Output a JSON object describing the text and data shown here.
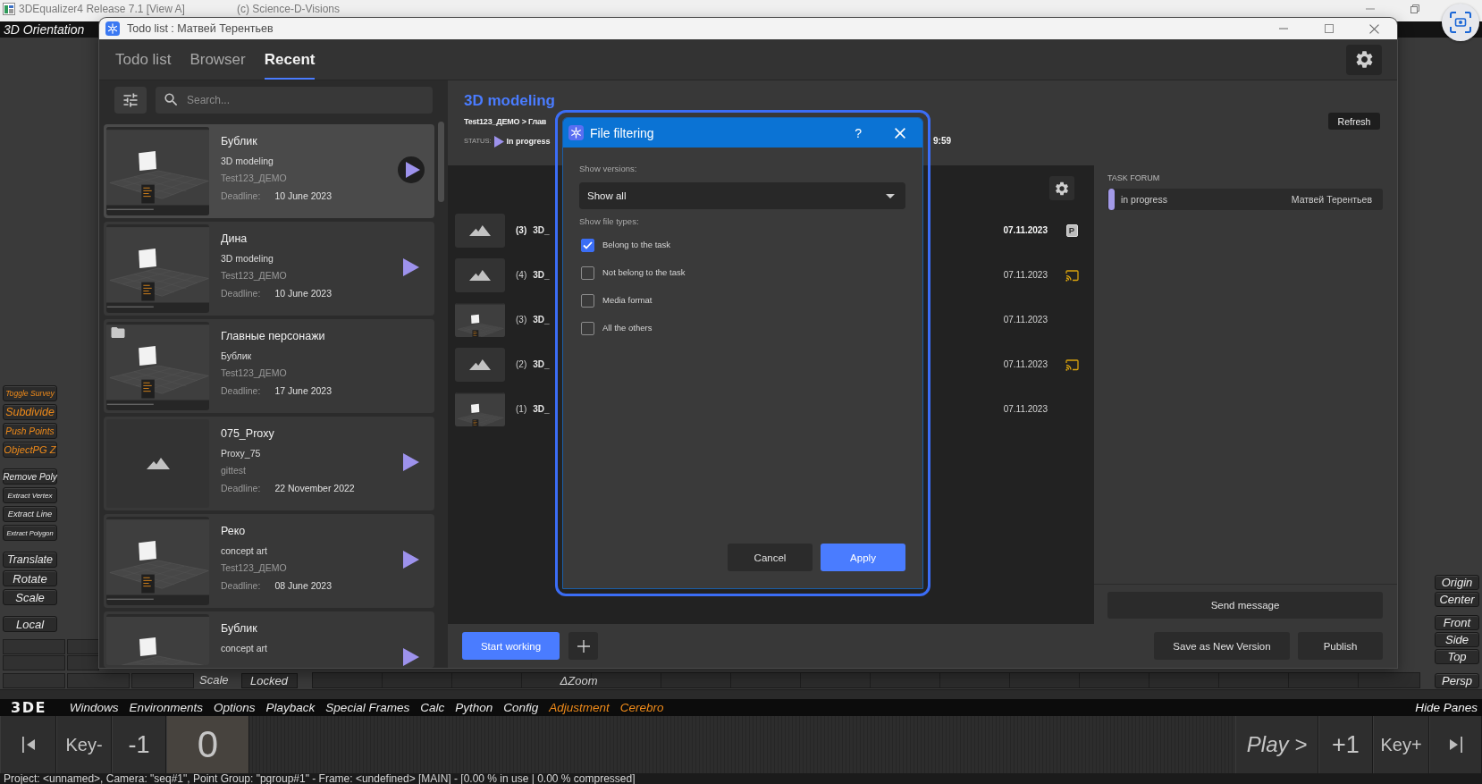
{
  "app_window": {
    "title": "3DEqualizer4 Release 7.1 [View A]",
    "copyright": "(c) Science-D-Visions"
  },
  "top_menu": [
    {
      "label": "3D Orientation"
    }
  ],
  "left_toolbar": [
    [
      {
        "label": "Toggle Survey",
        "kind": "accent"
      },
      {
        "label": "Subdivide",
        "kind": "accent"
      },
      {
        "label": "Push Points",
        "kind": "accent"
      },
      {
        "label": "ObjectPG Z",
        "kind": "accent"
      }
    ],
    [
      {
        "label": "Remove Poly",
        "kind": "plain"
      },
      {
        "label": "Extract Vertex",
        "kind": "plain"
      },
      {
        "label": "Extract Line",
        "kind": "plain"
      },
      {
        "label": "Extract Polygon",
        "kind": "plain"
      }
    ],
    [
      {
        "label": "Translate",
        "kind": "plain"
      },
      {
        "label": "Rotate",
        "kind": "plain"
      },
      {
        "label": "Scale",
        "kind": "plain"
      }
    ],
    [
      {
        "label": "Local",
        "kind": "plain"
      }
    ]
  ],
  "right_toolbar": [
    [
      "Origin",
      "Center"
    ],
    [
      "Front",
      "Side",
      "Top"
    ]
  ],
  "view_bar": {
    "scale_label": "Scale",
    "lock_button": "Locked",
    "zoom_label": "ΔZoom",
    "view_button": "Persp"
  },
  "menu_bar": {
    "logo": "3DE",
    "items": [
      {
        "label": "Windows",
        "kind": "plain"
      },
      {
        "label": "Environments",
        "kind": "plain"
      },
      {
        "label": "Options",
        "kind": "plain"
      },
      {
        "label": "Playback",
        "kind": "plain"
      },
      {
        "label": "Special Frames",
        "kind": "plain"
      },
      {
        "label": "Calc",
        "kind": "plain"
      },
      {
        "label": "Python",
        "kind": "plain"
      },
      {
        "label": "Config",
        "kind": "plain"
      },
      {
        "label": "Adjustment",
        "kind": "accent"
      },
      {
        "label": "Cerebro",
        "kind": "accent"
      }
    ],
    "right_item": "Hide Panes"
  },
  "timeline": {
    "left": [
      {
        "kind": "icon"
      },
      {
        "kind": "text",
        "label": "Key-"
      },
      {
        "kind": "text",
        "label": "-1"
      },
      {
        "kind": "frame",
        "label": "0"
      }
    ],
    "right": [
      {
        "kind": "play",
        "label": "Play >"
      },
      {
        "kind": "text",
        "label": "+1"
      },
      {
        "kind": "text",
        "label": "Key+"
      },
      {
        "kind": "icon"
      }
    ]
  },
  "status_line": "Project: <unnamed>, Camera: \"seq#1\", Point Group: \"pgroup#1\" - Frame: <undefined> [MAIN] - [0.00 % in use | 0.00 % compressed]",
  "todo_window": {
    "title": "Todo list : Матвей Терентьев",
    "tabs": [
      {
        "label": "Todo list",
        "selected": false
      },
      {
        "label": "Browser",
        "selected": false
      },
      {
        "label": "Recent",
        "selected": true
      }
    ],
    "search": {
      "placeholder": "Search..."
    },
    "cards": [
      {
        "title": "Бублик",
        "task": "3D modeling",
        "project": "Test123_ДЕМО",
        "deadline_label": "Deadline:",
        "deadline": "10 June 2023",
        "thumbnail": {
          "kind": "scene"
        },
        "folder": false,
        "play_button": true,
        "selected": true
      },
      {
        "title": "Дина",
        "task": "3D modeling",
        "project": "Test123_ДЕМО",
        "deadline_label": "Deadline:",
        "deadline": "10 June 2023",
        "thumbnail": {
          "kind": "scene"
        },
        "folder": false,
        "play_button": true,
        "selected": false
      },
      {
        "title": "Главные персонажи",
        "task": "Бублик",
        "project": "Test123_ДЕМО",
        "deadline_label": "Deadline:",
        "deadline": "17 June 2023",
        "thumbnail": {
          "kind": "scene"
        },
        "folder": true,
        "play_button": false,
        "selected": false
      },
      {
        "title": "075_Proxy",
        "task": "Proxy_75",
        "project": "gittest",
        "deadline_label": "Deadline:",
        "deadline": "22 November 2022",
        "thumbnail": {
          "kind": "placeholder"
        },
        "folder": false,
        "play_button": true,
        "selected": false
      },
      {
        "title": "Реко",
        "task": "concept art",
        "project": "Test123_ДЕМО",
        "deadline_label": "Deadline:",
        "deadline": "08 June 2023",
        "thumbnail": {
          "kind": "scene"
        },
        "folder": false,
        "play_button": true,
        "selected": false
      },
      {
        "title": "Бублик",
        "task": "concept art",
        "thumbnail": {
          "kind": "scene"
        },
        "folder": false,
        "play_button": true,
        "selected": false
      }
    ],
    "task": {
      "title": "3D modeling",
      "breadcrumb": "Test123_ДЕМО > Глав",
      "status_label": "STATUS:",
      "status": "In progress",
      "time": "9:59",
      "refresh": "Refresh"
    },
    "files": [
      {
        "thumbnail": {
          "kind": "placeholder"
        },
        "number": "(3)",
        "name": "3D_",
        "date": "07.11.2023",
        "current": true,
        "marker": {
          "kind": "letter",
          "text": "P"
        }
      },
      {
        "thumbnail": {
          "kind": "placeholder"
        },
        "number": "(4)",
        "name": "3D_",
        "date": "07.11.2023",
        "current": false,
        "marker": {
          "kind": "cast"
        }
      },
      {
        "thumbnail": {
          "kind": "scene"
        },
        "number": "(3)",
        "name": "3D_",
        "date": "07.11.2023",
        "current": false
      },
      {
        "thumbnail": {
          "kind": "placeholder"
        },
        "number": "(2)",
        "name": "3D_",
        "date": "07.11.2023",
        "current": false,
        "marker": {
          "kind": "cast"
        }
      },
      {
        "thumbnail": {
          "kind": "scene"
        },
        "number": "(1)",
        "name": "3D_",
        "date": "07.11.2023",
        "current": false
      }
    ],
    "forum": {
      "title": "TASK FORUM",
      "messages": [
        {
          "status": "in progress",
          "author": "Матвей Терентьев"
        }
      ],
      "send": "Send message"
    },
    "actions": {
      "start": "Start working",
      "save": "Save as New Version",
      "publish": "Publish"
    }
  },
  "file_filter_dialog": {
    "title": "File filtering",
    "help": "?",
    "versions_label": "Show versions:",
    "versions_value": "Show all",
    "types_label": "Show file types:",
    "types": [
      {
        "label": "Belong to the task",
        "checked": true
      },
      {
        "label": "Not belong to the task",
        "checked": false
      },
      {
        "label": "Media format",
        "checked": false
      },
      {
        "label": "All the others",
        "checked": false
      }
    ],
    "buttons": [
      {
        "label": "Cancel",
        "kind": "secondary"
      },
      {
        "label": "Apply",
        "kind": "primary"
      }
    ]
  }
}
